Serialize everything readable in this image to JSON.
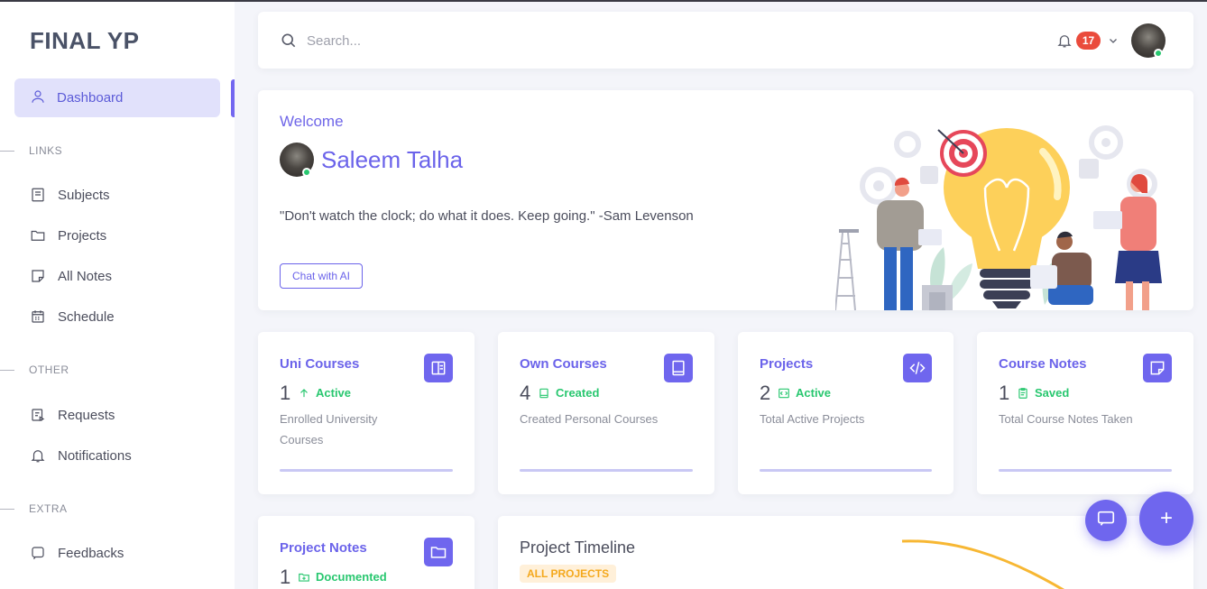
{
  "brand": "FINAL YP",
  "sidebar": {
    "active": {
      "label": "Dashboard",
      "icon": "user-icon"
    },
    "sections": [
      {
        "title": "LINKS",
        "items": [
          {
            "label": "Subjects",
            "icon": "book-icon"
          },
          {
            "label": "Projects",
            "icon": "folder-icon"
          },
          {
            "label": "All Notes",
            "icon": "note-icon"
          },
          {
            "label": "Schedule",
            "icon": "calendar-icon"
          }
        ]
      },
      {
        "title": "OTHER",
        "items": [
          {
            "label": "Requests",
            "icon": "request-icon"
          },
          {
            "label": "Notifications",
            "icon": "bell-icon"
          }
        ]
      },
      {
        "title": "EXTRA",
        "items": [
          {
            "label": "Feedbacks",
            "icon": "feedback-icon"
          }
        ]
      }
    ]
  },
  "header": {
    "search_placeholder": "Search...",
    "notification_count": "17"
  },
  "welcome": {
    "label": "Welcome",
    "user_name": "Saleem Talha",
    "quote": "\"Don't watch the clock; do what it does. Keep going.\" -Sam Levenson",
    "chat_button": "Chat with AI"
  },
  "cards": [
    {
      "title": "Uni Courses",
      "count": "1",
      "status": "Active",
      "description": "Enrolled University Courses",
      "icon": "layout-icon",
      "status_icon": "arrow-up-icon"
    },
    {
      "title": "Own Courses",
      "count": "4",
      "status": "Created",
      "description": "Created Personal Courses",
      "icon": "book-icon",
      "status_icon": "book-icon"
    },
    {
      "title": "Projects",
      "count": "2",
      "status": "Active",
      "description": "Total Active Projects",
      "icon": "code-icon",
      "status_icon": "code-icon"
    },
    {
      "title": "Course Notes",
      "count": "1",
      "status": "Saved",
      "description": "Total Course Notes Taken",
      "icon": "note-icon",
      "status_icon": "clipboard-icon"
    },
    {
      "title": "Project Notes",
      "count": "1",
      "status": "Documented",
      "description": "",
      "icon": "folder-icon",
      "status_icon": "folder-plus-icon"
    }
  ],
  "timeline": {
    "title": "Project Timeline",
    "badge": "ALL PROJECTS"
  },
  "fabs": {
    "chat_icon": "chat-icon",
    "add_label": "+"
  },
  "colors": {
    "accent": "#6f66ee",
    "success": "#28c76f",
    "danger": "#ea4b3c",
    "warning": "#f4a81c"
  }
}
